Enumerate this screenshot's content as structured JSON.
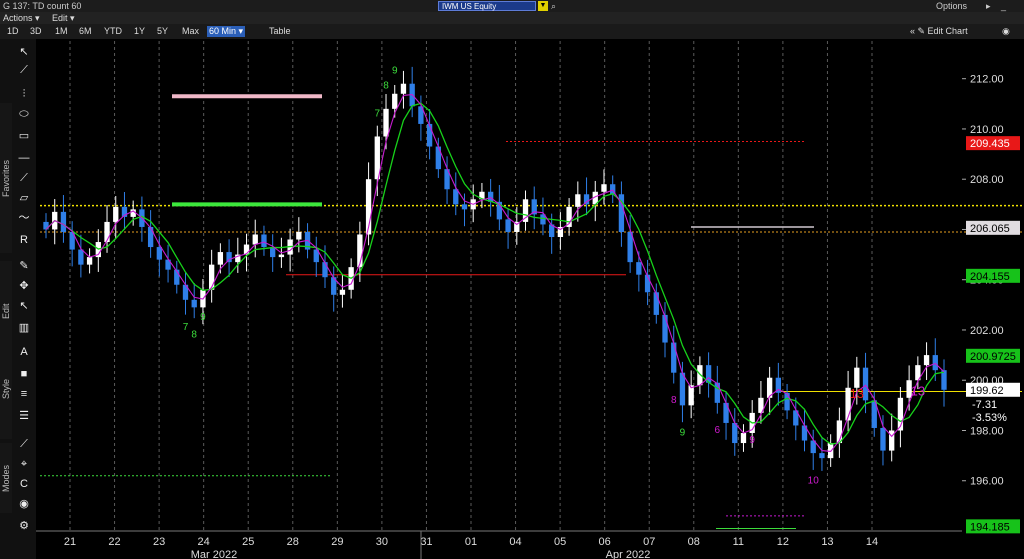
{
  "header": {
    "window_title": "G 137: TD count 60",
    "ticker": "IWM US Equity",
    "options_label": "Options",
    "window_controls": "▸ _ □ ✕"
  },
  "menu": {
    "actions": "Actions ▾",
    "edit": "Edit ▾"
  },
  "range_buttons": [
    "1D",
    "3D",
    "1M",
    "6M",
    "YTD",
    "1Y",
    "5Y",
    "Max",
    "60 Min ▾",
    "Table"
  ],
  "range_selected": "60 Min ▾",
  "edit_chart": "«  ✎ Edit Chart",
  "pin": "◉",
  "sidebar": {
    "favorites": "Favorites",
    "edit": "Edit",
    "style": "Style",
    "modes": "Modes"
  },
  "colors": {
    "up_candle": "#ffffff",
    "down_candle": "#2f7fe8",
    "ma_green": "#17d21a",
    "ma_magenta": "#c81ad2",
    "td_sell_green": "#3cdc3c",
    "td_buy_magenta": "#d21ad2",
    "td13_red": "#e81818",
    "yellow_level": "#f0e000",
    "orange_level": "#e8a020"
  },
  "chart_data": {
    "type": "candlestick",
    "y_ticks": [
      "212.00",
      "210.00",
      "208.00",
      "206.00",
      "204.00",
      "202.00",
      "200.00",
      "198.00",
      "196.00"
    ],
    "ylim": [
      194.0,
      213.5
    ],
    "x_ticks": [
      "21",
      "22",
      "23",
      "24",
      "25",
      "28",
      "29",
      "30",
      "31",
      "01",
      "04",
      "05",
      "06",
      "07",
      "08",
      "11",
      "12",
      "13",
      "14"
    ],
    "months": [
      "Mar 2022",
      "Apr 2022"
    ],
    "price_tags": [
      {
        "value": 209.435,
        "label": "209.435",
        "bg": "#e81818",
        "fg": "#ffffff"
      },
      {
        "value": 206.065,
        "label": "206.065",
        "bg": "#e0dce0",
        "fg": "#000000"
      },
      {
        "value": 204.155,
        "label": "204.155",
        "bg": "#17c21a",
        "fg": "#000000"
      },
      {
        "value": 200.9725,
        "label": "200.9725",
        "bg": "#17c21a",
        "fg": "#000000"
      },
      {
        "value": 199.62,
        "label": "199.62",
        "bg": "#ffffff",
        "fg": "#000000"
      },
      {
        "value": 194.185,
        "label": "194.185",
        "bg": "#17c21a",
        "fg": "#000000"
      }
    ],
    "last_change": {
      "abs": "-7.31",
      "pct": "-3.53%"
    },
    "closes": [
      206.0,
      206.7,
      205.9,
      205.2,
      204.6,
      204.9,
      205.5,
      206.3,
      206.9,
      206.5,
      206.8,
      206.1,
      205.3,
      204.8,
      204.4,
      203.8,
      203.2,
      202.9,
      203.6,
      204.6,
      205.1,
      204.7,
      205.0,
      205.4,
      205.8,
      205.3,
      204.9,
      205.0,
      205.6,
      205.9,
      205.2,
      204.7,
      204.1,
      203.4,
      203.6,
      204.5,
      205.8,
      208.0,
      209.7,
      210.8,
      211.4,
      211.8,
      210.9,
      210.2,
      209.3,
      208.4,
      207.6,
      207.0,
      206.8,
      207.2,
      207.5,
      207.1,
      206.4,
      205.9,
      206.3,
      207.2,
      206.6,
      206.2,
      205.7,
      206.1,
      206.9,
      207.4,
      207.0,
      207.5,
      207.8,
      207.4,
      205.9,
      204.7,
      204.2,
      203.5,
      202.6,
      201.5,
      200.3,
      199.0,
      199.8,
      200.6,
      199.9,
      199.1,
      198.3,
      197.5,
      197.9,
      198.7,
      199.3,
      200.1,
      199.5,
      198.8,
      198.2,
      197.6,
      197.1,
      196.9,
      197.5,
      198.4,
      199.7,
      200.5,
      199.2,
      198.1,
      197.2,
      198.0,
      199.3,
      200.0,
      200.6,
      201.0,
      200.4,
      199.62
    ],
    "indicator_lines": [
      {
        "name": "ma_green",
        "color": "#17d21a"
      },
      {
        "name": "ma_magenta",
        "color": "#c81ad2"
      }
    ],
    "td_labels": [
      {
        "text": "9",
        "i": 40,
        "side": "above",
        "color": "#3cdc3c"
      },
      {
        "text": "8",
        "i": 39,
        "side": "above",
        "color": "#3cdc3c"
      },
      {
        "text": "7",
        "i": 38,
        "side": "above",
        "color": "#3cdc3c"
      },
      {
        "text": "9",
        "i": 18,
        "side": "below",
        "color": "#3cdc3c"
      },
      {
        "text": "8",
        "i": 17,
        "side": "below",
        "color": "#3cdc3c"
      },
      {
        "text": "7",
        "i": 16,
        "side": "below",
        "color": "#3cdc3c"
      },
      {
        "text": "9",
        "i": 73,
        "side": "below",
        "color": "#3cdc3c"
      },
      {
        "text": "8",
        "i": 72,
        "side": "below",
        "color": "#d21ad2"
      },
      {
        "text": "6",
        "i": 77,
        "side": "below",
        "color": "#d21ad2"
      },
      {
        "text": "9",
        "i": 81,
        "side": "below",
        "color": "#d21ad2"
      },
      {
        "text": "10",
        "i": 88,
        "side": "below",
        "color": "#d21ad2"
      },
      {
        "text": "13",
        "i": 93,
        "side": "below",
        "color": "#e81818"
      },
      {
        "text": "13",
        "i": 100,
        "side": "below",
        "color": "#d21ad2"
      }
    ]
  }
}
